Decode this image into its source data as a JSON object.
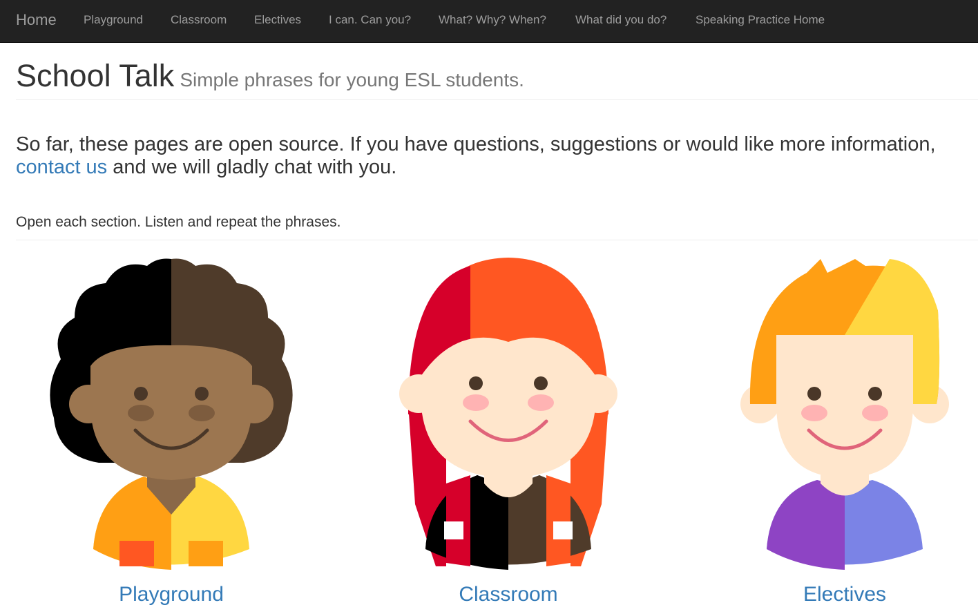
{
  "nav": {
    "brand": "Home",
    "items": [
      "Playground",
      "Classroom",
      "Electives",
      "I can. Can you?",
      "What? Why? When?",
      "What did you do?",
      "Speaking Practice Home"
    ]
  },
  "header": {
    "title": "School Talk",
    "subtitle": "Simple phrases for young ESL students."
  },
  "intro": {
    "text_before": "So far, these pages are open source. If you have questions, suggestions or would like more information,",
    "link": "contact us",
    "text_after": " and we will gladly chat with you."
  },
  "instructions": "Open each section. Listen and repeat the phrases.",
  "sections": [
    {
      "label": "Playground",
      "icon": "curly-haired-child-avatar-icon"
    },
    {
      "label": "Classroom",
      "icon": "red-haired-girl-avatar-icon"
    },
    {
      "label": "Electives",
      "icon": "blond-boy-avatar-icon"
    }
  ],
  "colors": {
    "navbar": "#222222",
    "link": "#337ab7",
    "muted": "#777777"
  }
}
